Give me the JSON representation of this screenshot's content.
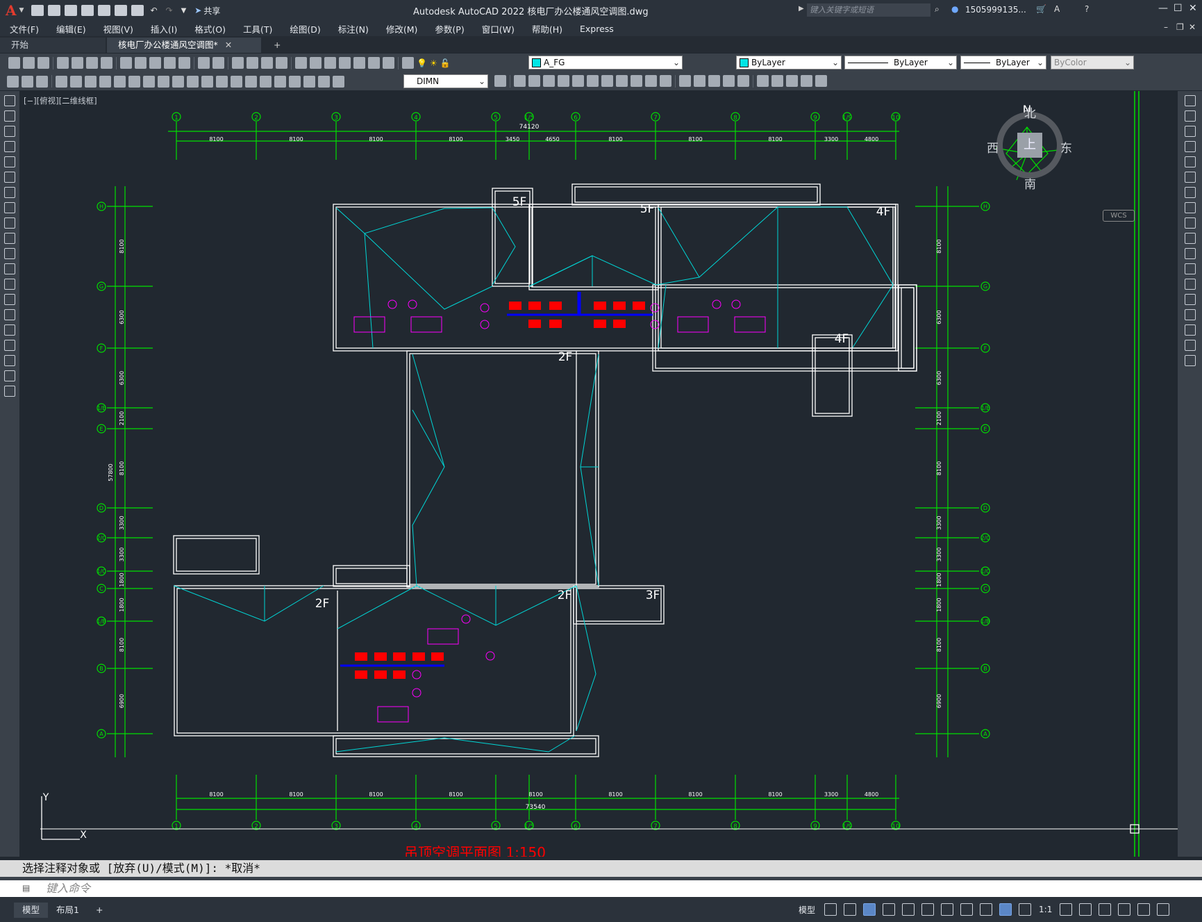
{
  "app": {
    "title": "Autodesk AutoCAD 2022    核电厂办公楼通风空调图.dwg",
    "share_label": "共享",
    "search_placeholder": "键入关键字或短语",
    "user_label": "1505999135...",
    "logo_letter": "A"
  },
  "menu": [
    "文件(F)",
    "编辑(E)",
    "视图(V)",
    "插入(I)",
    "格式(O)",
    "工具(T)",
    "绘图(D)",
    "标注(N)",
    "修改(M)",
    "参数(P)",
    "窗口(W)",
    "帮助(H)",
    "Express"
  ],
  "tabs": {
    "start": "开始",
    "active": "核电厂办公楼通风空调图*",
    "add": "+"
  },
  "toolbar": {
    "layer_value": "A_FG",
    "color_value": "ByLayer",
    "linetype_value": "ByLayer",
    "lineweight_value": "ByLayer",
    "plotstyle_value": "ByColor",
    "dimstyle_value": "DIMN"
  },
  "viewport": {
    "label": "[−][俯视][二维线框]"
  },
  "viewcube": {
    "north": "北",
    "south": "南",
    "east": "东",
    "west": "西",
    "top": "上",
    "wcs": "WCS",
    "compass_n": "N"
  },
  "drawing": {
    "top_grid_labels": [
      "1",
      "2",
      "3",
      "4",
      "5",
      "1/5",
      "6",
      "7",
      "8",
      "9",
      "1/9",
      "10"
    ],
    "top_dims": [
      "8100",
      "8100",
      "8100",
      "8100",
      "3450",
      "4650",
      "8100",
      "8100",
      "8100",
      "3300",
      "4800"
    ],
    "top_total": "74120",
    "bottom_dims": [
      "8100",
      "8100",
      "8100",
      "8100",
      "8100",
      "8100",
      "8100",
      "8100",
      "3300",
      "4800"
    ],
    "bottom_total": "73540",
    "side_grid_labels": [
      "H",
      "G",
      "F",
      "1/E",
      "E",
      "D",
      "2/C",
      "1/C",
      "C",
      "1/B",
      "B",
      "A"
    ],
    "left_dims": [
      "8100",
      "6300",
      "6300",
      "2100",
      "8100",
      "3300",
      "3300",
      "1800",
      "1800",
      "8100",
      "6900"
    ],
    "left_total": "57800",
    "floor_labels": [
      "5F",
      "5F",
      "4F",
      "4F",
      "2F",
      "2F",
      "2F",
      "3F"
    ],
    "bottom_title": "吊顶空调平面图 1:150"
  },
  "command": {
    "history": "选择注释对象或 [放弃(U)/模式(M)]: *取消*",
    "placeholder": "键入命令"
  },
  "status": {
    "model_tab": "模型",
    "layout_tab": "布局1",
    "model_label": "模型",
    "scale": "1:1"
  },
  "colors": {
    "grid": "#00e000",
    "wall": "#ffffff",
    "roof": "#00d6d6",
    "duct": "#ff0000",
    "tag": "#ff00ff",
    "pipe": "#0000ff",
    "bg": "#212830"
  }
}
